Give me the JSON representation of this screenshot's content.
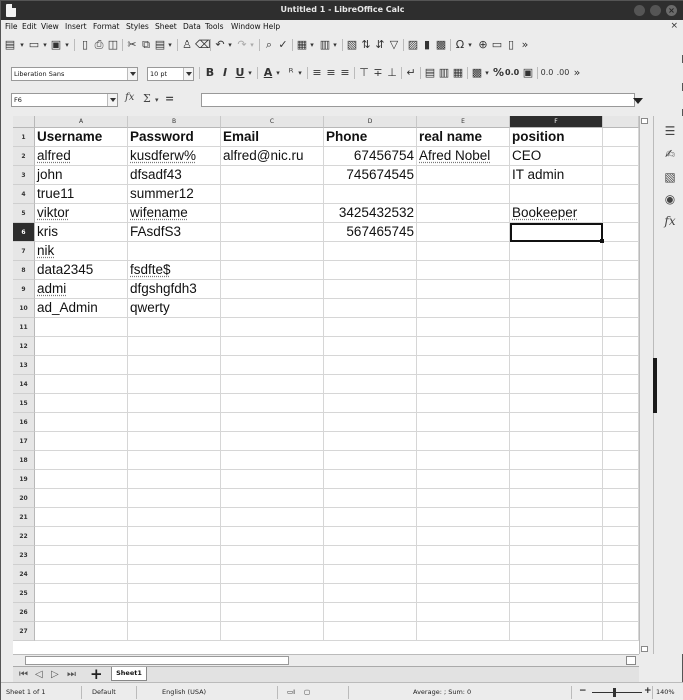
{
  "window": {
    "title": "Untitled 1 - LibreOffice Calc",
    "close_glyph": "×"
  },
  "menu": {
    "items": [
      "File",
      "Edit",
      "View",
      "Insert",
      "Format",
      "Styles",
      "Sheet",
      "Data",
      "Tools",
      "Window",
      "Help"
    ],
    "close_glyph": "×"
  },
  "toolbar": {
    "font_name": "Liberation Sans",
    "font_size": "10 pt",
    "bold": "B",
    "italic": "I",
    "underline": "U",
    "font_color": "A",
    "currency": "%",
    "decimal1": "0.0",
    "decimal2": ".00",
    "more": "»",
    "standard_more": "»"
  },
  "formula_bar": {
    "name_box": "F6",
    "fx": "fx",
    "sum": "Σ",
    "equals": "=",
    "value": ""
  },
  "columns": [
    "A",
    "B",
    "C",
    "D",
    "E",
    "F"
  ],
  "rows": [
    "1",
    "2",
    "3",
    "4",
    "5",
    "6",
    "7",
    "8",
    "9",
    "10",
    "11",
    "12",
    "13",
    "14",
    "15",
    "16",
    "17",
    "18",
    "19",
    "20",
    "21",
    "22",
    "23",
    "24",
    "25",
    "26",
    "27"
  ],
  "active_cell": "F6",
  "cells": {
    "r1": {
      "a": "Username",
      "b": "Password",
      "c": "Email",
      "d": "Phone",
      "e": "real name",
      "f": "position"
    },
    "r2": {
      "a": "alfred",
      "b": "kusdferw%",
      "c": "alfred@nic.ru",
      "d": "67456754",
      "e": "Afred Nobel",
      "f": "CEO"
    },
    "r3": {
      "a": "john",
      "b": "dfsadf43",
      "c": "",
      "d": "745674545",
      "e": "",
      "f": "IT admin"
    },
    "r4": {
      "a": "true11",
      "b": "summer12",
      "c": "",
      "d": "",
      "e": "",
      "f": ""
    },
    "r5": {
      "a": "viktor",
      "b": "wifename",
      "c": "",
      "d": "3425432532",
      "e": "",
      "f": "Bookeeper"
    },
    "r6": {
      "a": "kris",
      "b": "FAsdfS3",
      "c": "",
      "d": "567465745",
      "e": "",
      "f": ""
    },
    "r7": {
      "a": "nik",
      "b": "",
      "c": "",
      "d": "",
      "e": "",
      "f": ""
    },
    "r8": {
      "a": "data2345",
      "b": "fsdfte$",
      "c": "",
      "d": "",
      "e": "",
      "f": ""
    },
    "r9": {
      "a": "admi",
      "b": "dfgshgfdh3",
      "c": "",
      "d": "",
      "e": "",
      "f": ""
    },
    "r10": {
      "a": "ad_Admin",
      "b": "qwerty",
      "c": "",
      "d": "",
      "e": "",
      "f": ""
    }
  },
  "sheet_tabs": {
    "active": "Sheet1",
    "add": "+"
  },
  "status_bar": {
    "sheet": "Sheet 1 of 1",
    "page_style": "Default",
    "language": "English (USA)",
    "summary": "Average: ; Sum: 0",
    "zoom_minus": "−",
    "zoom_plus": "+",
    "zoom": "140%"
  },
  "sidebar": {
    "icons": [
      "properties-icon",
      "styles-icon",
      "gallery-icon",
      "navigator-icon",
      "functions-icon"
    ],
    "functions_label": "fx"
  }
}
